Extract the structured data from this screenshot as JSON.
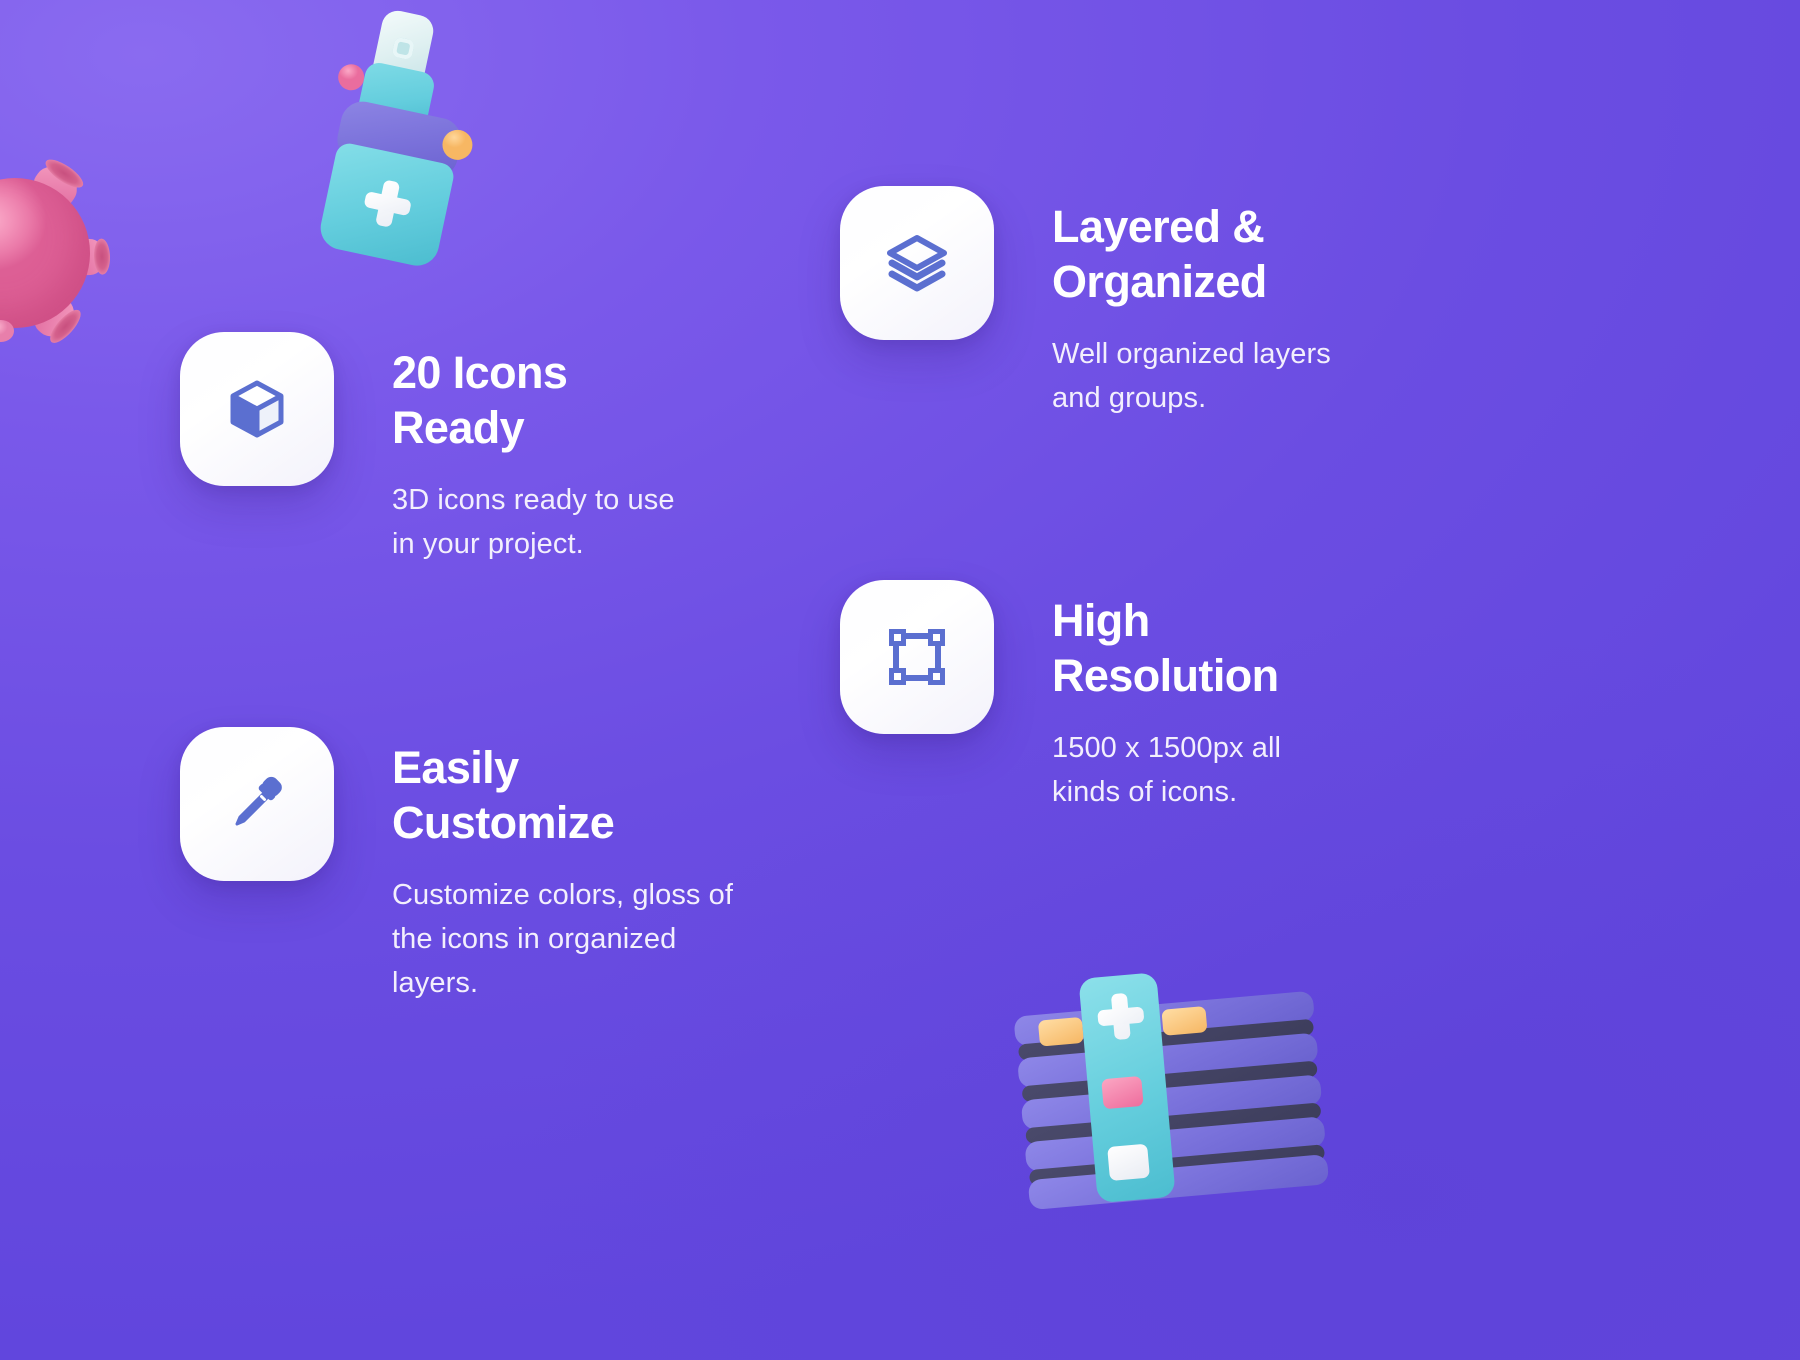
{
  "theme": {
    "background_color": "#6c4fe0",
    "tile_color": "#ffffff",
    "icon_color": "#5b6fd0",
    "title_color": "#ffffff",
    "body_color": "#f3effd"
  },
  "features": [
    {
      "id": "icons-ready",
      "icon": "cube-icon",
      "title": "20 Icons\nReady",
      "description": "3D icons ready to use\nin your project."
    },
    {
      "id": "easily-customize",
      "icon": "eyedropper-icon",
      "title": "Easily\nCustomize",
      "description": "Customize colors, gloss of\nthe icons in organized\nlayers."
    },
    {
      "id": "layered-organized",
      "icon": "layers-icon",
      "title": "Layered &\nOrganized",
      "description": "Well organized layers\nand groups."
    },
    {
      "id": "high-resolution",
      "icon": "transform-box-icon",
      "title": "High\nResolution",
      "description": "1500 x 1500px all\nkinds of icons."
    }
  ],
  "decorations": [
    {
      "id": "virus",
      "name": "virus-3d-object",
      "color": "#ea79a8"
    },
    {
      "id": "spray",
      "name": "spray-bottle-3d-object",
      "color": "#63cddd"
    },
    {
      "id": "hospital",
      "name": "hospital-building-3d-object",
      "color": "#7b73dc"
    }
  ]
}
